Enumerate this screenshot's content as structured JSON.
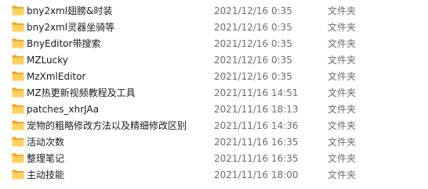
{
  "folder_icon": "folder-icon",
  "colors": {
    "folder_front": "#ffd15c",
    "folder_back": "#e8a628",
    "meta_text": "#6d6d6d"
  },
  "files": [
    {
      "name": "bny2xml翅膀&时装",
      "date": "2021/12/16 0:35",
      "type": "文件夹"
    },
    {
      "name": "bny2xml灵器坐骑等",
      "date": "2021/12/16 0:35",
      "type": "文件夹"
    },
    {
      "name": "BnyEditor带搜索",
      "date": "2021/12/16 0:35",
      "type": "文件夹"
    },
    {
      "name": "MZLucky",
      "date": "2021/12/16 0:35",
      "type": "文件夹"
    },
    {
      "name": "MzXmlEditor",
      "date": "2021/12/16 0:35",
      "type": "文件夹"
    },
    {
      "name": "MZ热更新视频教程及工具",
      "date": "2021/11/16 14:51",
      "type": "文件夹"
    },
    {
      "name": "patches_xhrJAa",
      "date": "2021/11/16 18:13",
      "type": "文件夹"
    },
    {
      "name": "宠物的粗略修改方法以及精细修改区别",
      "date": "2021/11/16 14:36",
      "type": "文件夹"
    },
    {
      "name": "活动次数",
      "date": "2021/11/16 16:35",
      "type": "文件夹"
    },
    {
      "name": "整理笔记",
      "date": "2021/11/16 16:35",
      "type": "文件夹"
    },
    {
      "name": "主动技能",
      "date": "2021/11/16 18:00",
      "type": "文件夹"
    }
  ]
}
